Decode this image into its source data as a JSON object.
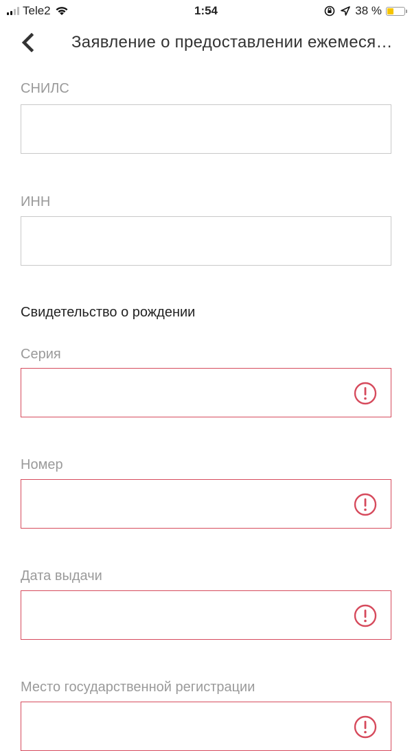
{
  "status_bar": {
    "carrier": "Tele2",
    "time": "1:54",
    "battery_percent": "38 %",
    "battery_level": 0.38,
    "icons": [
      "signal-icon",
      "wifi-icon",
      "orientation-lock-icon",
      "location-icon",
      "battery-icon"
    ]
  },
  "nav": {
    "back_icon": "chevron-left-icon",
    "title": "Заявление о предоставлении ежемесячной выплаты"
  },
  "form": {
    "snils_label": "СНИЛС",
    "snils_value": "",
    "inn_label": "ИНН",
    "inn_value": "",
    "section_title": "Свидетельство о рождении",
    "series_label": "Серия",
    "series_value": "",
    "number_label": "Номер",
    "number_value": "",
    "issue_date_label": "Дата выдачи",
    "issue_date_value": "",
    "registration_place_label": "Место государственной регистрации",
    "registration_place_value": ""
  },
  "colors": {
    "error": "#d64a5c",
    "border": "#c8c8c8",
    "label": "#9a9a9a",
    "battery": "#f5c400"
  }
}
